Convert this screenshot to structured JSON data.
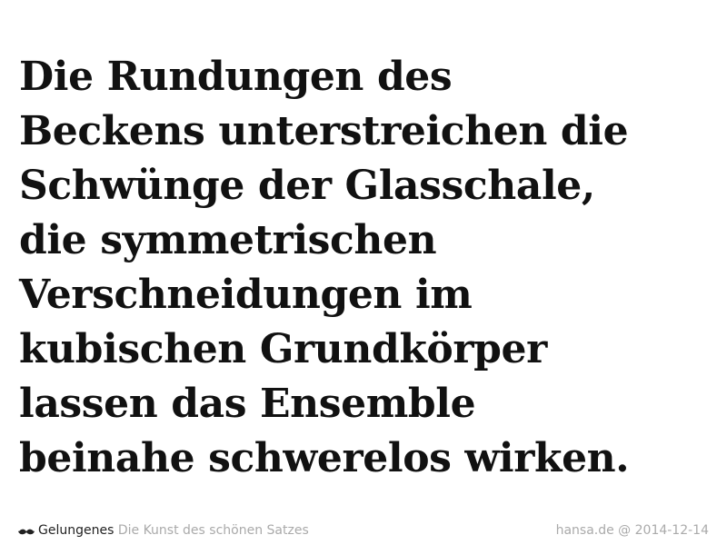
{
  "quote": {
    "lines": [
      "Die Rundungen des",
      "Beckens unterstreichen die",
      "Schwünge der Glasschale,",
      "die symmetrischen",
      "Verschneidungen im",
      "kubischen Grundkörper",
      "lassen das Ensemble",
      "beinahe schwerelos wirken."
    ]
  },
  "footer": {
    "icon": "mustache-icon",
    "brand": "Gelungenes",
    "tagline": "Die Kunst des schönen Satzes",
    "source": "hansa.de @ 2014-12-14"
  },
  "colors": {
    "text": "#111111",
    "muted": "#aaaaaa",
    "background": "#ffffff"
  }
}
